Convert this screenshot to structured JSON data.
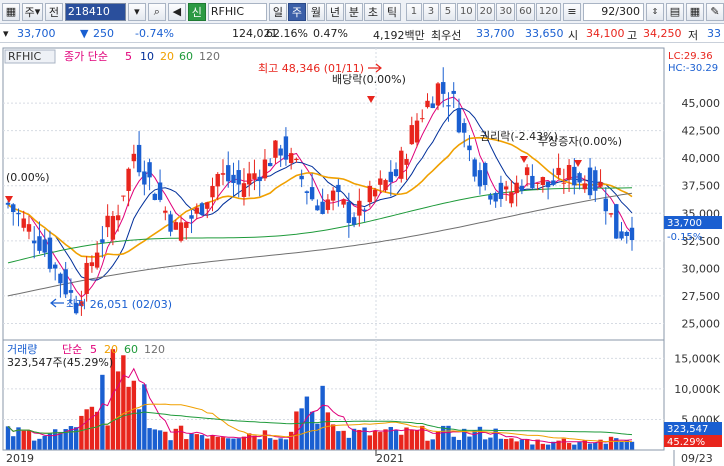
{
  "toolbar": {
    "menu_label": "주",
    "total_label": "전",
    "stock_code": "218410",
    "stock_name": "RFHIC",
    "period_buttons": [
      "일",
      "주",
      "월",
      "년",
      "분",
      "초",
      "틱"
    ],
    "selected_period": "주",
    "interval_buttons": [
      "1",
      "3",
      "5",
      "10",
      "20",
      "30",
      "60",
      "120"
    ],
    "count_display": "92/300"
  },
  "infobar": {
    "price": "33,700",
    "change": "250",
    "change_pct": "-0.74%",
    "volume": "124,021",
    "volume_ratio": "62.16%",
    "turnover_pct": "0.47%",
    "amount": "4,192백만",
    "priority_label": "최우선",
    "ask": "33,700",
    "bid": "33,650",
    "open_label": "시",
    "open": "34,100",
    "high_label": "고",
    "high": "34,250",
    "low_label": "저",
    "low": "33"
  },
  "price_panel": {
    "title": "RFHIC",
    "legend_label": "종가 단순",
    "ma_periods": [
      "5",
      "10",
      "20",
      "60",
      "120"
    ],
    "lc_label": "LC:29.36",
    "hc_label": "HC:-30.29",
    "current_price_tag": "33,700",
    "current_pct_tag": "-0.15%",
    "annotations": {
      "high": "최고 48,346 (01/11)",
      "low": "최저 26,051 (02/03)",
      "dividend": "배당락(0.00%)",
      "rights": "권리락(-2.43%)",
      "bonus": "무상증자(0.00%)",
      "left_event": "(0.00%)"
    }
  },
  "volume_panel": {
    "legend_label": "거래량",
    "ma_label": "단순",
    "ma_periods": [
      "5",
      "20",
      "60",
      "120"
    ],
    "first_bar_label": "323,547주(45.29%)",
    "current_volume_tag": "323,547",
    "current_pct_tag": "45.29%"
  },
  "x_axis": {
    "labels": [
      "2019",
      "2021",
      "09/23"
    ]
  },
  "chart_data": {
    "type": "candlestick",
    "price_axis": {
      "ticks": [
        "45,000",
        "42,500",
        "40,000",
        "37,500",
        "35,000",
        "32,500",
        "30,000",
        "27,500",
        "25,000"
      ],
      "ylim": [
        23500,
        50000
      ]
    },
    "volume_axis": {
      "ticks": [
        "15,000K",
        "10,000K",
        "5,000K"
      ],
      "ylim": [
        0,
        18000
      ]
    },
    "x_axis_labels": [
      "2019",
      "2021"
    ],
    "series": [
      {
        "name": "5",
        "color": "#e0007a"
      },
      {
        "name": "10",
        "color": "#002f9a"
      },
      {
        "name": "20",
        "color": "#f0a000"
      },
      {
        "name": "60",
        "color": "#1e9a3a"
      },
      {
        "name": "120",
        "color": "#707070"
      }
    ],
    "colors": {
      "up": "#e8251d",
      "down": "#1a5fd1"
    }
  }
}
